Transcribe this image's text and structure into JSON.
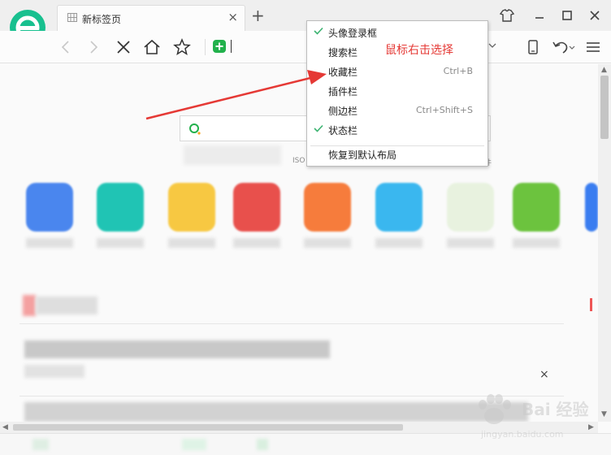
{
  "tab": {
    "title": "新标签页",
    "close": "×",
    "new_tab": "+"
  },
  "context_menu": {
    "items": [
      {
        "label": "头像登录框",
        "checked": true,
        "accel": ""
      },
      {
        "label": "搜索栏",
        "checked": false,
        "accel": ""
      },
      {
        "label": "收藏栏",
        "checked": false,
        "accel": "Ctrl+B"
      },
      {
        "label": "插件栏",
        "checked": false,
        "accel": ""
      },
      {
        "label": "侧边栏",
        "checked": false,
        "accel": "Ctrl+Shift+S"
      },
      {
        "label": "状态栏",
        "checked": true,
        "accel": ""
      },
      {
        "label": "恢复到默认布局",
        "checked": false,
        "accel": ""
      }
    ],
    "annotation": "鼠标右击选择"
  },
  "page": {
    "search_hint": "ISO",
    "search_hint_right": "件",
    "close_x": "×"
  },
  "watermark": {
    "brand": "Bai 经验",
    "sub": "jingyan.baidu.com"
  },
  "colors": {
    "check": "#3cb371",
    "annotation": "#e53935",
    "logo": "#18c08f"
  },
  "icons": [
    "logo-icon",
    "tab-grid-icon",
    "skin-icon",
    "minimize-icon",
    "maximize-icon",
    "close-window-icon",
    "back-icon",
    "forward-icon",
    "stop-icon",
    "home-icon",
    "star-icon",
    "shield-plus-icon",
    "device-icon",
    "undo-icon",
    "menu-icon",
    "search-icon"
  ]
}
